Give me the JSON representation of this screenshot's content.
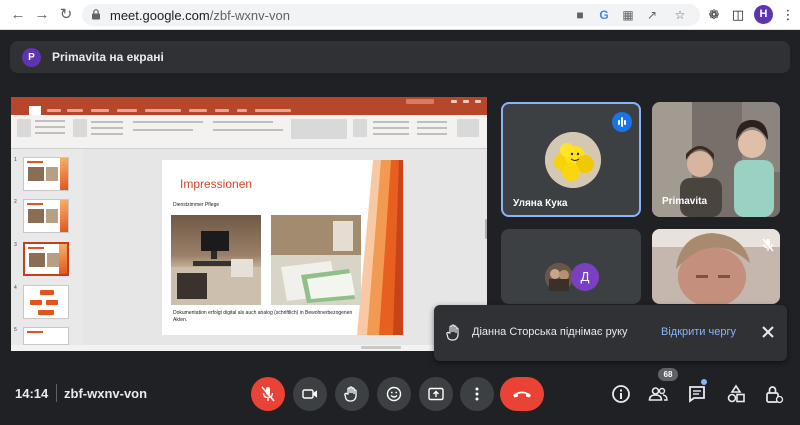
{
  "browser": {
    "url_host": "meet.google.com",
    "url_path": "/zbf-wxnv-von",
    "profile_initial": "H",
    "icons": [
      "back-icon",
      "forward-icon",
      "reload-icon",
      "lock-icon",
      "camera-icon",
      "google-icon",
      "translate-icon",
      "share-icon",
      "star-icon",
      "extensions-icon",
      "sidepanel-icon",
      "menu-icon"
    ]
  },
  "banner": {
    "avatar_initial": "P",
    "text": "Primavita на екрані"
  },
  "shared_screen": {
    "slide": {
      "title": "Impressionen",
      "subtitle": "Dienstzimmer Pflege",
      "caption": "Dokumentation erfolgt digital als auch analog (schriftlich) in Bewohnerbezogenen Akten."
    },
    "thumbnail_numbers": [
      "1",
      "2",
      "3",
      "4",
      "5"
    ]
  },
  "participants": [
    {
      "name": "Уляна Кука",
      "speaking": true
    },
    {
      "name": "Primavita",
      "speaking": false
    },
    {
      "initial": "Д",
      "color": "#7b3fc4"
    },
    {
      "muted": true
    }
  ],
  "toast": {
    "text": "Діанна Сторська піднімає руку",
    "action": "Відкрити чергу"
  },
  "bottom_bar": {
    "time": "14:14",
    "meeting_code": "zbf-wxnv-von",
    "people_count": "68"
  },
  "colors": {
    "background": "#202124",
    "accent_blue": "#8ab4f8",
    "end_call_red": "#ea4335",
    "ppt_orange": "#b7472a"
  }
}
